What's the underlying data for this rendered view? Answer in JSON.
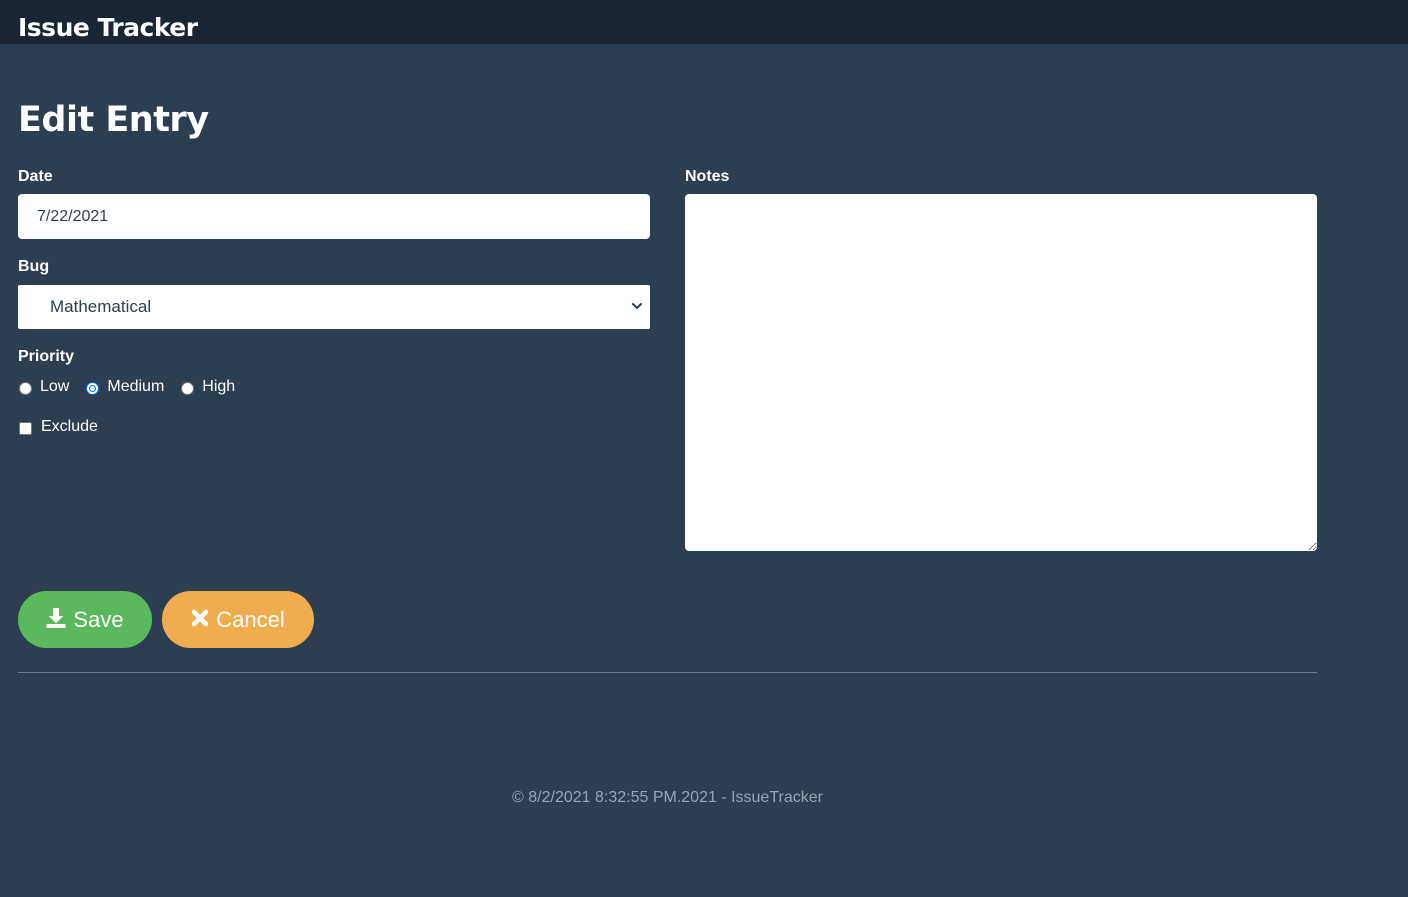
{
  "app": {
    "brand": "Issue Tracker"
  },
  "page": {
    "title": "Edit Entry"
  },
  "form": {
    "date": {
      "label": "Date",
      "value": "7/22/2021"
    },
    "bug": {
      "label": "Bug",
      "selected": "Mathematical"
    },
    "priority": {
      "label": "Priority",
      "options": [
        "Low",
        "Medium",
        "High"
      ],
      "selected": "Medium"
    },
    "exclude": {
      "label": "Exclude",
      "checked": false
    },
    "notes": {
      "label": "Notes",
      "value": ""
    }
  },
  "actions": {
    "save_label": "Save",
    "cancel_label": "Cancel",
    "save_color": "#5cb85c",
    "cancel_color": "#f0ad4e"
  },
  "footer": {
    "text": "© 8/2/2021 8:32:55 PM.2021 - IssueTracker"
  },
  "colors": {
    "background": "#2c3e50",
    "navbar": "#1a2533",
    "radio_accent": "#0075ff"
  },
  "icons": {
    "save": "download-icon",
    "cancel": "close-icon",
    "select": "chevron-down-icon"
  }
}
